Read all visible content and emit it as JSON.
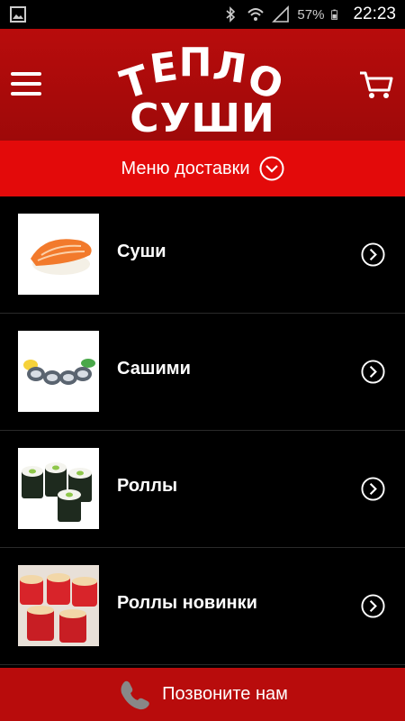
{
  "status_bar": {
    "battery": "57%",
    "time": "22:23"
  },
  "header": {
    "logo_line1": [
      "Т",
      "Е",
      "П",
      "Л",
      "О"
    ],
    "logo_line2": "СУШИ"
  },
  "delivery_menu": {
    "label": "Меню доставки"
  },
  "categories": [
    {
      "label": "Суши"
    },
    {
      "label": "Сашими"
    },
    {
      "label": "Роллы"
    },
    {
      "label": "Роллы новинки"
    }
  ],
  "call": {
    "label": "Позвоните нам"
  },
  "colors": {
    "header": "#b80c0c",
    "delivery_bar": "#e30a0a",
    "background": "#000000"
  }
}
